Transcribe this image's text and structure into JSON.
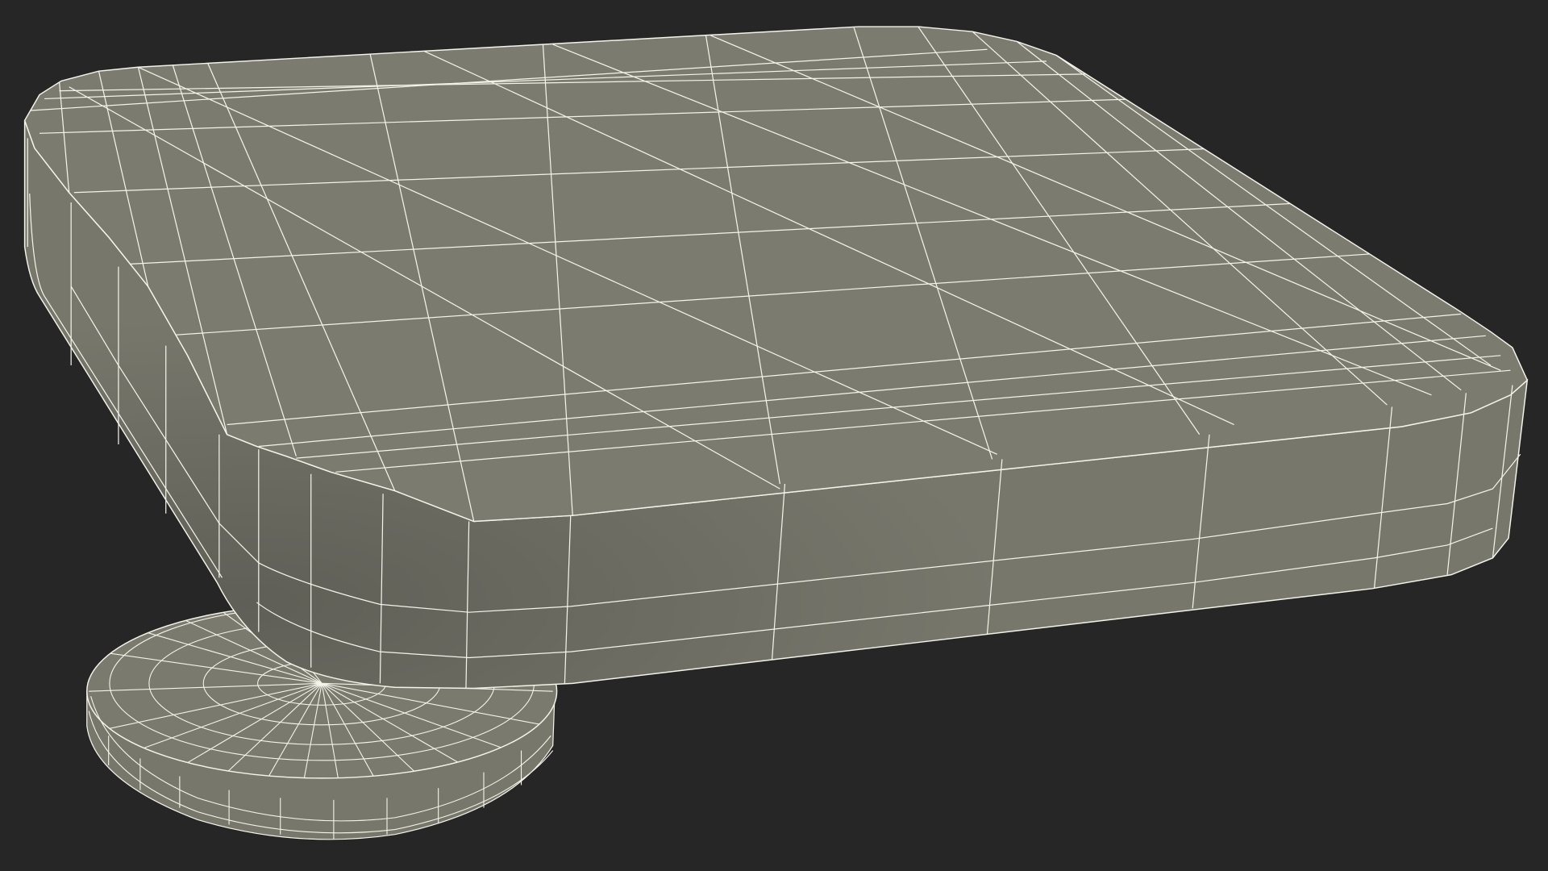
{
  "scene": {
    "background_color": "#262626",
    "surface_color": "#7b7b70",
    "shadow_color": "#5c5c54",
    "wire_color": "#f4f4ea"
  }
}
